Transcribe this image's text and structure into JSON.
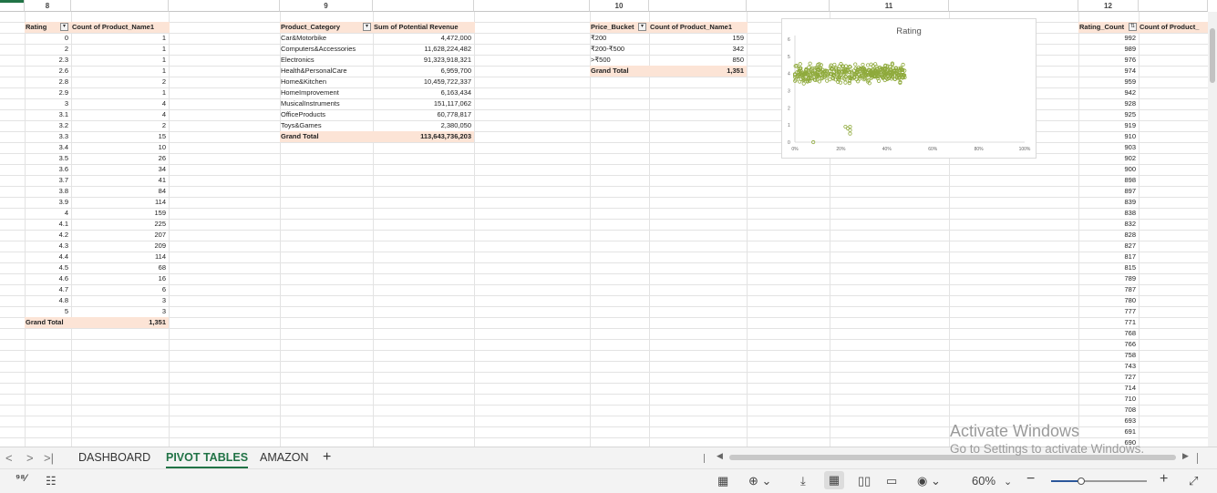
{
  "column_headers": [
    "8",
    "9",
    "10",
    "11",
    "12"
  ],
  "pivot_rating": {
    "header_label": "Rating",
    "value_header": "Count of Product_Name1",
    "rows": [
      [
        "0",
        "1"
      ],
      [
        "2",
        "1"
      ],
      [
        "2.3",
        "1"
      ],
      [
        "2.6",
        "1"
      ],
      [
        "2.8",
        "2"
      ],
      [
        "2.9",
        "1"
      ],
      [
        "3",
        "4"
      ],
      [
        "3.1",
        "4"
      ],
      [
        "3.2",
        "2"
      ],
      [
        "3.3",
        "15"
      ],
      [
        "3.4",
        "10"
      ],
      [
        "3.5",
        "26"
      ],
      [
        "3.6",
        "34"
      ],
      [
        "3.7",
        "41"
      ],
      [
        "3.8",
        "84"
      ],
      [
        "3.9",
        "114"
      ],
      [
        "4",
        "159"
      ],
      [
        "4.1",
        "225"
      ],
      [
        "4.2",
        "207"
      ],
      [
        "4.3",
        "209"
      ],
      [
        "4.4",
        "114"
      ],
      [
        "4.5",
        "68"
      ],
      [
        "4.6",
        "16"
      ],
      [
        "4.7",
        "6"
      ],
      [
        "4.8",
        "3"
      ],
      [
        "5",
        "3"
      ]
    ],
    "grand_total_label": "Grand Total",
    "grand_total_value": "1,351"
  },
  "pivot_category": {
    "header_label": "Product_Category",
    "value_header": "Sum of Potential Revenue",
    "rows": [
      [
        "Car&Motorbike",
        "4,472,000"
      ],
      [
        "Computers&Accessories",
        "11,628,224,482"
      ],
      [
        "Electronics",
        "91,323,918,321"
      ],
      [
        "Health&PersonalCare",
        "6,959,700"
      ],
      [
        "Home&Kitchen",
        "10,459,722,337"
      ],
      [
        "HomeImprovement",
        "6,163,434"
      ],
      [
        "MusicalInstruments",
        "151,117,062"
      ],
      [
        "OfficeProducts",
        "60,778,817"
      ],
      [
        "Toys&Games",
        "2,380,050"
      ]
    ],
    "grand_total_label": "Grand Total",
    "grand_total_value": "113,643,736,203"
  },
  "pivot_price": {
    "header_label": "Price_Bucket",
    "value_header": "Count of Product_Name1",
    "rows": [
      [
        "₹200",
        "159"
      ],
      [
        "₹200-₹500",
        "342"
      ],
      [
        ">₹500",
        "850"
      ]
    ],
    "grand_total_label": "Grand Total",
    "grand_total_value": "1,351"
  },
  "pivot_rating_count": {
    "header_label": "Rating_Count",
    "value_header": "Count of Product_",
    "values": [
      "992",
      "989",
      "976",
      "974",
      "959",
      "942",
      "928",
      "925",
      "919",
      "910",
      "903",
      "902",
      "900",
      "898",
      "897",
      "839",
      "838",
      "832",
      "828",
      "827",
      "817",
      "815",
      "789",
      "787",
      "780",
      "777",
      "771",
      "768",
      "766",
      "758",
      "743",
      "727",
      "714",
      "710",
      "708",
      "693",
      "691",
      "690"
    ]
  },
  "chart_data": {
    "type": "scatter",
    "title": "Rating",
    "x_ticks": [
      "0%",
      "20%",
      "40%",
      "60%",
      "80%",
      "100%"
    ],
    "y_ticks": [
      "0",
      "1",
      "2",
      "3",
      "4",
      "5",
      "6"
    ],
    "xlim": [
      0,
      1
    ],
    "ylim": [
      0,
      6
    ],
    "grid": false,
    "color": "#8faa3c",
    "outliers": [
      [
        0.08,
        0.0
      ],
      [
        0.24,
        0.5
      ],
      [
        0.24,
        0.7
      ],
      [
        0.24,
        0.9
      ],
      [
        0.22,
        0.9
      ],
      [
        0.23,
        0.8
      ]
    ],
    "main_cluster": {
      "x_range": [
        0,
        0.48
      ],
      "y_center": 4.0,
      "y_spread": 0.45,
      "count": 420
    }
  },
  "sheet_tabs": {
    "nav_prev": "<",
    "nav_next": ">",
    "nav_last": ">|",
    "tabs": [
      "DASHBOARD",
      "PIVOT TABLES",
      "AMAZON"
    ],
    "active": 1,
    "add": "+"
  },
  "statusbar": {
    "zoom": "60%",
    "zoom_fraction": 0.3,
    "minus": "−",
    "plus": "+"
  },
  "watermark": {
    "line1": "Activate Windows",
    "line2": "Go to Settings to activate Windows."
  }
}
